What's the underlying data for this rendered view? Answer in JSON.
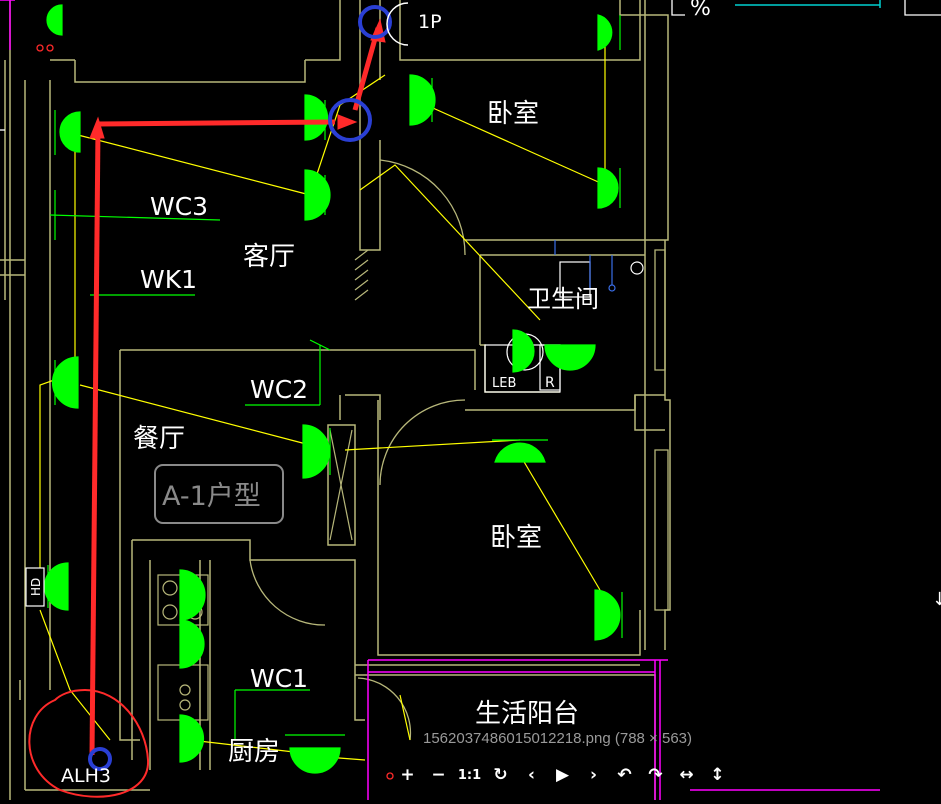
{
  "viewer": {
    "caption": "1562037486015012218.png (788 × 563)",
    "toolbar": [
      {
        "name": "zoom-in-button",
        "glyph": "+"
      },
      {
        "name": "zoom-out-button",
        "glyph": "−"
      },
      {
        "name": "actual-size-button",
        "glyph": "1:1"
      },
      {
        "name": "refresh-button",
        "glyph": "↻"
      },
      {
        "name": "previous-button",
        "glyph": "‹"
      },
      {
        "name": "play-button",
        "glyph": "▶"
      },
      {
        "name": "next-button",
        "glyph": "›"
      },
      {
        "name": "rotate-left-button",
        "glyph": "↶"
      },
      {
        "name": "rotate-right-button",
        "glyph": "↷"
      },
      {
        "name": "flip-horizontal-button",
        "glyph": "↔"
      },
      {
        "name": "flip-vertical-button",
        "glyph": "↕"
      }
    ]
  },
  "drawing": {
    "labels": {
      "breaker": "1P",
      "bedroom_top": "卧室",
      "wc3": "WC3",
      "living_room": "客厅",
      "wk1": "WK1",
      "bathroom": "卫生间",
      "leb": "LEB",
      "r_mark": "R",
      "wc2": "WC2",
      "dining_room": "餐厅",
      "unit_type": "A-1户型",
      "bedroom_bottom": "卧室",
      "hd": "HD",
      "wc1": "WC1",
      "kitchen": "厨房",
      "balcony": "生活阳台",
      "panel": "ALH3",
      "corner_mark": "%"
    },
    "colors": {
      "wall": "#b7b77a",
      "wire": "#ffff00",
      "fixture": "#00ff00",
      "red_markup": "#ff2a2a",
      "blue_markup": "#2a3fd4",
      "magenta_line": "#ff00ff",
      "cyan_line": "#00ffff",
      "text": "#ffffff"
    }
  }
}
